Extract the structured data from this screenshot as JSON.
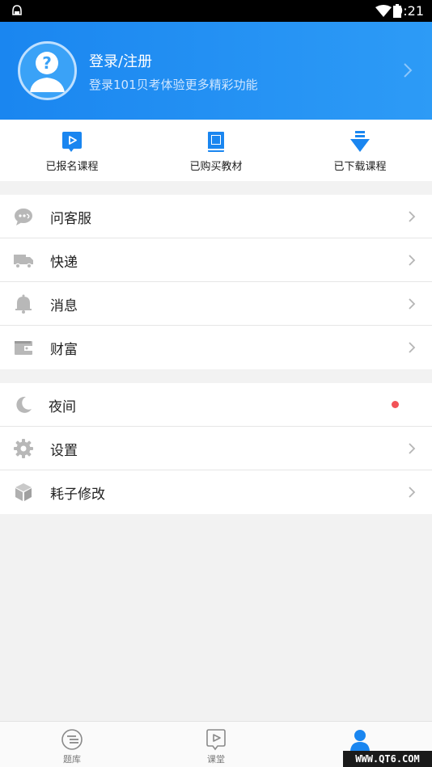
{
  "status_bar": {
    "time": "9:21"
  },
  "header": {
    "title": "登录/注册",
    "subtitle": "登录101贝考体验更多精彩功能"
  },
  "quick_actions": [
    {
      "label": "已报名课程",
      "icon": "play-bubble-icon"
    },
    {
      "label": "已购买教材",
      "icon": "book-icon"
    },
    {
      "label": "已下载课程",
      "icon": "download-icon"
    }
  ],
  "menu_group_1": [
    {
      "label": "问客服",
      "icon": "chat-icon"
    },
    {
      "label": "快递",
      "icon": "truck-icon"
    },
    {
      "label": "消息",
      "icon": "bell-icon"
    },
    {
      "label": "财富",
      "icon": "wallet-icon"
    }
  ],
  "menu_group_2": [
    {
      "label": "夜间",
      "icon": "moon-icon"
    },
    {
      "label": "设置",
      "icon": "gear-icon"
    },
    {
      "label": "耗子修改",
      "icon": "cube-icon"
    }
  ],
  "tabs": [
    {
      "label": "题库",
      "icon": "list-icon"
    },
    {
      "label": "课堂",
      "icon": "play-bubble-icon"
    },
    {
      "label": "",
      "icon": "person-icon",
      "active": true
    }
  ],
  "watermark": "WWW.QT6.COM",
  "colors": {
    "primary": "#1a86f0",
    "red_dot": "#f25257"
  }
}
